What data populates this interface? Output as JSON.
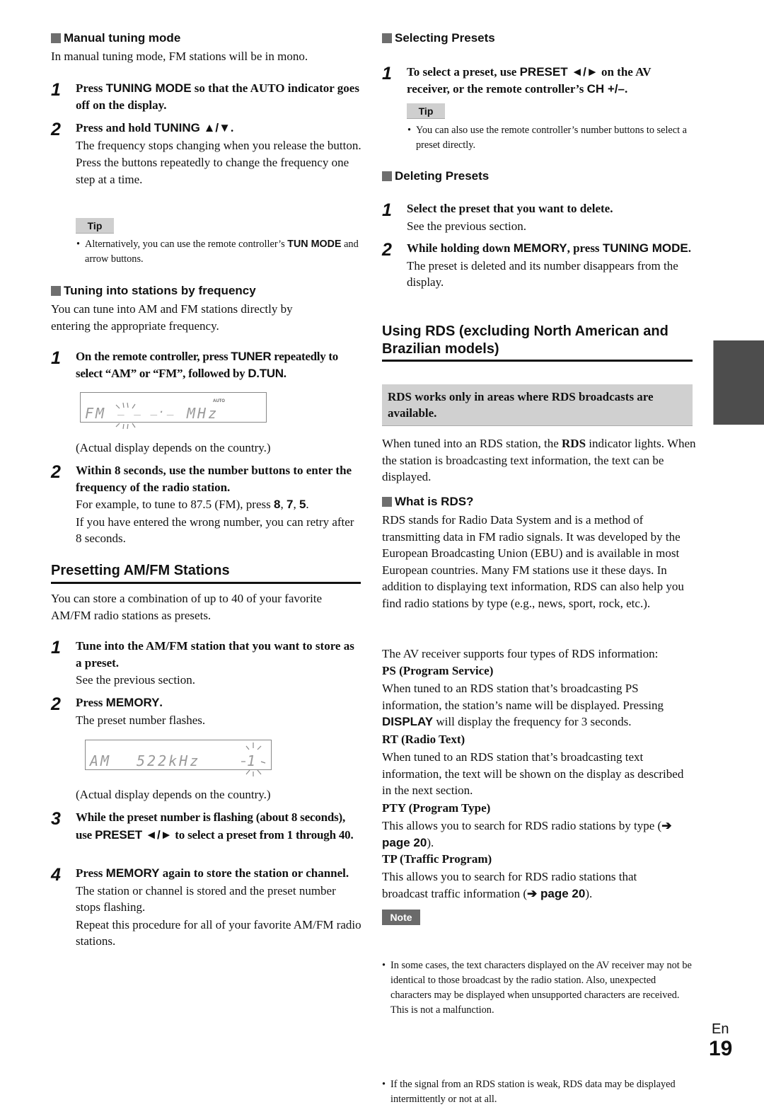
{
  "left": {
    "manual": {
      "heading": "Manual tuning mode",
      "intro": "In manual tuning mode, FM stations will be in mono.",
      "step1": {
        "num": "1",
        "pre": "Press ",
        "kw": "TUNING MODE",
        "post": " so that the AUTO indicator goes off on the display."
      },
      "step2": {
        "num": "2",
        "pre": "Press and hold ",
        "kw": "TUNING ▲/▼",
        "post": ".",
        "p1": "The frequency stops changing when you release the button.",
        "p2": "Press the buttons repeatedly to change the frequency one step at a time."
      },
      "tip_label": "Tip",
      "tip_pre": "Alternatively, you can use the remote controller’s ",
      "tip_kw": "TUN MODE",
      "tip_post": " and arrow buttons."
    },
    "freq": {
      "heading": "Tuning into stations by frequency",
      "intro": "You can tune into AM and FM stations directly by entering the appropriate frequency.",
      "step1": {
        "num": "1",
        "pre": "On the remote controller, press ",
        "kw1": "TUNER",
        "mid": " repeatedly to select “AM” or “FM”, followed by ",
        "kw2": "D.TUN",
        "post": "."
      },
      "display1": {
        "band": "FM",
        "digits": "_ _ _._",
        "unit": "MHz",
        "indicator": "AUTO"
      },
      "display_caption": "(Actual display depends on the country.)",
      "step2": {
        "num": "2",
        "title": "Within 8 seconds, use the number buttons to enter the frequency of the radio station.",
        "p1_pre": "For example, to tune to 87.5 (FM), press ",
        "p1_k1": "8",
        "p1_k2": "7",
        "p1_k3": "5",
        "p2": "If you have entered the wrong number, you can retry after 8 seconds."
      }
    },
    "preset": {
      "title": "Presetting AM/FM Stations",
      "intro": "You can store a combination of up to 40 of your favorite AM/FM radio stations as presets.",
      "step1": {
        "num": "1",
        "title": "Tune into the AM/FM station that you want to store as a preset.",
        "p1": "See the previous section."
      },
      "step2": {
        "num": "2",
        "pre": "Press ",
        "kw": "MEMORY",
        "post": ".",
        "p1": "The preset number flashes."
      },
      "display2": {
        "band": "AM",
        "freq": "522kHz",
        "preset_no": "1"
      },
      "display_caption": "(Actual display depends on the country.)",
      "step3": {
        "num": "3",
        "pre": "While the preset number is flashing (about 8 seconds), use ",
        "kw": "PRESET ◄/►",
        "post": " to select a preset from 1 through 40."
      },
      "step4": {
        "num": "4",
        "pre": "Press ",
        "kw": "MEMORY",
        "post": " again to store the station or channel.",
        "p1": "The station or channel is stored and the preset number stops flashing.",
        "p2": "Repeat this procedure for all of your favorite AM/FM radio stations."
      }
    }
  },
  "right": {
    "selecting": {
      "heading": "Selecting Presets",
      "step1": {
        "num": "1",
        "pre": "To select a preset, use ",
        "kw1": "PRESET ◄/►",
        "mid": " on the AV receiver, or the remote controller’s ",
        "kw2": "CH +/–",
        "post": "."
      },
      "tip_label": "Tip",
      "tip_text": "You can also use the remote controller’s number buttons to select a preset directly."
    },
    "deleting": {
      "heading": "Deleting Presets",
      "step1": {
        "num": "1",
        "title": "Select the preset that you want to delete.",
        "p1": "See the previous section."
      },
      "step2": {
        "num": "2",
        "pre": "While holding down ",
        "kw1": "MEMORY",
        "mid": ", press ",
        "kw2": "TUNING MODE",
        "post": ".",
        "p1": "The preset is deleted and its number disappears from the display."
      }
    },
    "rds": {
      "title": "Using RDS (excluding North American and Brazilian models)",
      "box": "RDS works only in areas where RDS broadcasts are available.",
      "intro_pre": "When tuned into an RDS station, the ",
      "intro_bold": "RDS",
      "intro_post": " indicator lights. When the station is broadcasting text information, the text can be displayed.",
      "what_heading": "What is RDS?",
      "what_text": "RDS stands for Radio Data System and is a method of transmitting data in FM radio signals. It was developed by the European Broadcasting Union (EBU) and is available in most European countries. Many FM stations use it these days. In addition to displaying text information, RDS can also help you find radio stations by type (e.g., news, sport, rock, etc.).",
      "types_intro": "The AV receiver supports four types of RDS information:",
      "ps_title": "PS (Program Service)",
      "ps_pre": "When tuned to an RDS station that’s broadcasting PS information, the station’s name will be displayed. Pressing ",
      "ps_kw": "DISPLAY",
      "ps_post": " will display the frequency for 3 seconds.",
      "rt_title": "RT (Radio Text)",
      "rt_text": "When tuned to an RDS station that’s broadcasting text information, the text will be shown on the display as described in the next section.",
      "pty_title": "PTY (Program Type)",
      "pty_pre": "This allows you to search for RDS radio stations by type (",
      "pty_link": "➔ page 20",
      "pty_post": ").",
      "tp_title": "TP (Traffic Program)",
      "tp_pre": "This allows you to search for RDS radio stations that broadcast traffic information (",
      "tp_link": "➔ page 20",
      "tp_post": ").",
      "note_label": "Note",
      "notes": [
        "In some cases, the text characters displayed on the AV receiver may not be identical to those broadcast by the radio station. Also, unexpected characters may be displayed when unsupported characters are received. This is not a malfunction.",
        "If the signal from an RDS station is weak, RDS data may be displayed intermittently or not at all."
      ]
    }
  },
  "footer": {
    "lang": "En",
    "page": "19"
  }
}
